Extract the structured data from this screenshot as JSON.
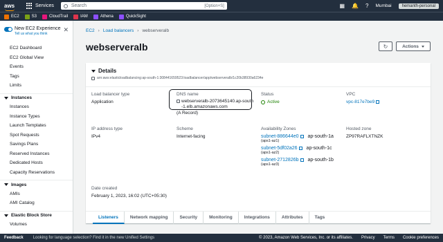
{
  "topbar": {
    "logo": "aws",
    "services_label": "Services",
    "search_placeholder": "Search",
    "search_shortcut": "[Option+S]",
    "region": "Mumbai",
    "account": "hemanth-personal"
  },
  "favorites": [
    {
      "label": "EC2",
      "color": "#ed7100"
    },
    {
      "label": "S3",
      "color": "#7aa116"
    },
    {
      "label": "CloudTrail",
      "color": "#e7157b"
    },
    {
      "label": "IAM",
      "color": "#dd344c"
    },
    {
      "label": "Athena",
      "color": "#8c4fff"
    },
    {
      "label": "QuickSight",
      "color": "#8c4fff"
    }
  ],
  "sidebar": {
    "experience_title": "New EC2 Experience",
    "experience_sub": "Tell us what you think",
    "top_items": [
      "EC2 Dashboard",
      "EC2 Global View",
      "Events",
      "Tags",
      "Limits"
    ],
    "instances_header": "Instances",
    "instances_items": [
      "Instances",
      "Instance Types",
      "Launch Templates",
      "Spot Requests",
      "Savings Plans",
      "Reserved Instances",
      "Dedicated Hosts",
      "Capacity Reservations"
    ],
    "images_header": "Images",
    "images_items": [
      "AMIs",
      "AMI Catalog"
    ],
    "ebs_header": "Elastic Block Store",
    "ebs_items": [
      "Volumes"
    ]
  },
  "breadcrumb": {
    "root": "EC2",
    "parent": "Load balancers",
    "current": "webserveralb"
  },
  "page_title": "webserveralb",
  "actions_label": "Actions",
  "details": {
    "title": "Details",
    "arn": "arn:aws:elasticloadbalancing:ap-south-1:308441659523:loadbalancer/app/webserveralb/1c20b38930a6234e",
    "lb_type_label": "Load balancer type",
    "lb_type": "Application",
    "dns_label": "DNS name",
    "dns_line1": "webserveralb-2073645140.ap-south",
    "dns_line2": "-1.elb.amazonaws.com",
    "dns_record": "(A Record)",
    "status_label": "Status",
    "status": "Active",
    "vpc_label": "VPC",
    "vpc": "vpc-817e7be9",
    "ip_label": "IP address type",
    "ip": "IPv4",
    "scheme_label": "Scheme",
    "scheme": "Internet-facing",
    "az_label": "Availability Zones",
    "azs": [
      {
        "subnet": "subnet-886644e0",
        "zone": "ap-south-1a",
        "id": "(aps1-az1)"
      },
      {
        "subnet": "subnet-5df02a26",
        "zone": "ap-south-1c",
        "id": "(aps1-az2)"
      },
      {
        "subnet": "subnet-2712826b",
        "zone": "ap-south-1b",
        "id": "(aps1-az3)"
      }
    ],
    "zone_label": "Hosted zone",
    "zone": "ZP97RAFLXTNZK",
    "created_label": "Date created",
    "created": "February 1, 2023, 16:02 (UTC+05:30)"
  },
  "tabs": [
    "Listeners",
    "Network mapping",
    "Security",
    "Monitoring",
    "Integrations",
    "Attributes",
    "Tags"
  ],
  "footer": {
    "feedback": "Feedback",
    "lang": "Looking for language selection? Find it in the new Unified Settings",
    "copyright": "© 2023, Amazon Web Services, Inc. or its affiliates.",
    "privacy": "Privacy",
    "terms": "Terms",
    "cookies": "Cookie preferences"
  }
}
